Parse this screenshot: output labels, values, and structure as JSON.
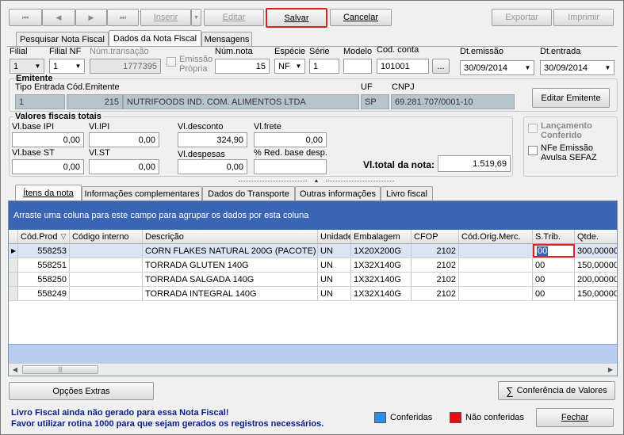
{
  "toolbar": {
    "first": "⏮",
    "prev": "◀",
    "next": "▶",
    "last": "⏭",
    "insert": "Inserir",
    "edit": "Editar",
    "save": "Salvar",
    "cancel": "Cancelar",
    "export": "Exportar",
    "print": "Imprimir"
  },
  "top_tabs": [
    "Pesquisar Nota Fiscal",
    "Dados da Nota Fiscal",
    "Mensagens"
  ],
  "header": {
    "filial_label": "Filial",
    "filial_value": "1",
    "filial_nf_label": "Filial NF",
    "filial_nf_value": "1",
    "num_transacao_label": "Núm.transação",
    "num_transacao_value": "1777395",
    "emissao_propria_label": "Emissão Própria",
    "num_nota_label": "Núm.nota",
    "num_nota_value": "15",
    "especie_label": "Espécie",
    "especie_value": "NF",
    "serie_label": "Série",
    "serie_value": "1",
    "modelo_label": "Modelo",
    "modelo_value": "",
    "cod_conta_label": "Cod. conta",
    "cod_conta_value": "101001",
    "cod_conta_btn": "...",
    "dt_emissao_label": "Dt.emissão",
    "dt_emissao_value": "30/09/2014",
    "dt_entrada_label": "Dt.entrada",
    "dt_entrada_value": "30/09/2014"
  },
  "emitente": {
    "title": "Emitente",
    "tipo_entrada_label": "Tipo Entrada",
    "tipo_entrada_value": "1",
    "cod_emitente_label": "Cód.Emitente",
    "cod_emitente_value": "215",
    "nome_value": "NUTRIFOODS IND. COM. ALIMENTOS LTDA",
    "uf_label": "UF",
    "uf_value": "SP",
    "cnpj_label": "CNPJ",
    "cnpj_value": "69.281.707/0001-10",
    "edit_button": "Editar Emitente"
  },
  "fiscais": {
    "title": "Valores fiscais totais",
    "vl_base_ipi_label": "Vl.base IPI",
    "vl_base_ipi": "0,00",
    "vl_ipi_label": "Vl.IPI",
    "vl_ipi": "0,00",
    "vl_desconto_label": "Vl.desconto",
    "vl_desconto": "324,90",
    "vl_frete_label": "Vl.frete",
    "vl_frete": "0,00",
    "vl_base_st_label": "Vl.base ST",
    "vl_base_st": "0,00",
    "vl_st_label": "Vl.ST",
    "vl_st": "0,00",
    "vl_despesas_label": "Vl.despesas",
    "vl_despesas": "0,00",
    "red_base_label": "% Red. base desp.",
    "red_base": "",
    "vl_total_label": "Vl.total da nota:",
    "vl_total": "1.519,69",
    "lancamento_label": "Lançamento Conferido",
    "nfe_label": "NFe Emissão Avulsa SEFAZ"
  },
  "sub_tabs": [
    "Ítens da nota",
    "Informações complementares",
    "Dados do Transporte",
    "Outras informações",
    "Livro fiscal"
  ],
  "grid": {
    "group_hint": "Arraste uma coluna para este campo para agrupar os dados por esta coluna",
    "columns": [
      "Cód.Prod",
      "Código interno",
      "Descrição",
      "Unidade",
      "Embalagem",
      "CFOP",
      "Cód.Orig.Merc.",
      "S.Trib.",
      "Qtde."
    ],
    "rows": [
      [
        "558253",
        "",
        "CORN FLAKES NATURAL 200G (PACOTE)",
        "UN",
        "1X20X200G",
        "2102",
        "",
        "00",
        "300,00000"
      ],
      [
        "558251",
        "",
        "TORRADA GLUTEN 140G",
        "UN",
        "1X32X140G",
        "2102",
        "",
        "00",
        "150,00000"
      ],
      [
        "558250",
        "",
        "TORRADA SALGADA 140G",
        "UN",
        "1X32X140G",
        "2102",
        "",
        "00",
        "200,00000"
      ],
      [
        "558249",
        "",
        "TORRADA INTEGRAL 140G",
        "UN",
        "1X32X140G",
        "2102",
        "",
        "00",
        "150,00000"
      ]
    ],
    "selected_row": 0
  },
  "bottom": {
    "opcoes_extras": "Opções Extras",
    "conferencia": "Conferência de Valores",
    "warning_line1": "Livro Fiscal ainda não gerado para essa Nota Fiscal!",
    "warning_line2": "Favor utilizar rotina 1000 para que sejam gerados os registros necessários.",
    "legend_conferidas": "Conferidas",
    "legend_nao_conferidas": "Não conferidas",
    "fechar": "Fechar"
  },
  "colors": {
    "accent_blue": "#3a64b4",
    "legend_blue": "#2f8fe8",
    "legend_red": "#e01010",
    "highlight_red": "#e02020",
    "warning_text": "#0a1e8c"
  }
}
